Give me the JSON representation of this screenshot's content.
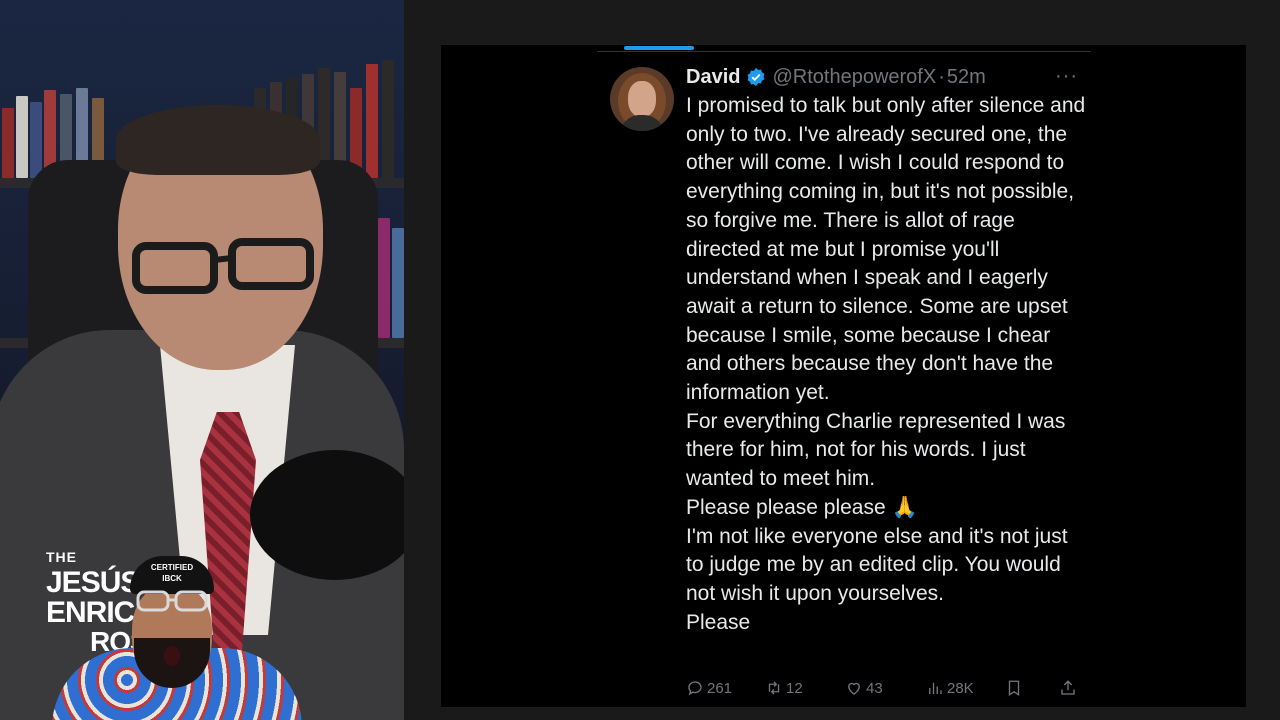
{
  "overlay": {
    "brand_the": "THE",
    "brand_line1": "JESÚS",
    "brand_line2": "ENRIC",
    "brand_line3": "ROS",
    "cap_text": "CERTIFIED\nIBCK"
  },
  "tweet": {
    "author_name": "David",
    "handle": "@RtothepowerofX",
    "separator": "·",
    "time": "52m",
    "more_label": "···",
    "text": "I promised to talk but only after silence and only to two. I've already secured one, the other will come. I wish I could respond to everything coming in, but it's not possible, so forgive me. There is allot of rage directed at me but I promise you'll understand when I speak and I eagerly await a return to silence. Some are upset because I smile, some because I chear and others because they don't have the information yet.\nFor everything Charlie represented I was there for him, not for his words. I just wanted to meet him.\n Please please please 🙏\nI'm not like everyone else and it's not just to judge me by an edited clip. You would not wish it upon yourselves.\nPlease",
    "replies": "261",
    "reposts": "12",
    "likes": "43",
    "views": "28K"
  },
  "colors": {
    "accent": "#1d9bf0",
    "text_primary": "#e7e9ea",
    "text_secondary": "#71767b",
    "panel_bg": "#000000"
  },
  "icons": [
    "verified-badge-icon",
    "more-icon",
    "reply-icon",
    "repost-icon",
    "like-icon",
    "views-icon",
    "bookmark-icon",
    "share-icon"
  ]
}
